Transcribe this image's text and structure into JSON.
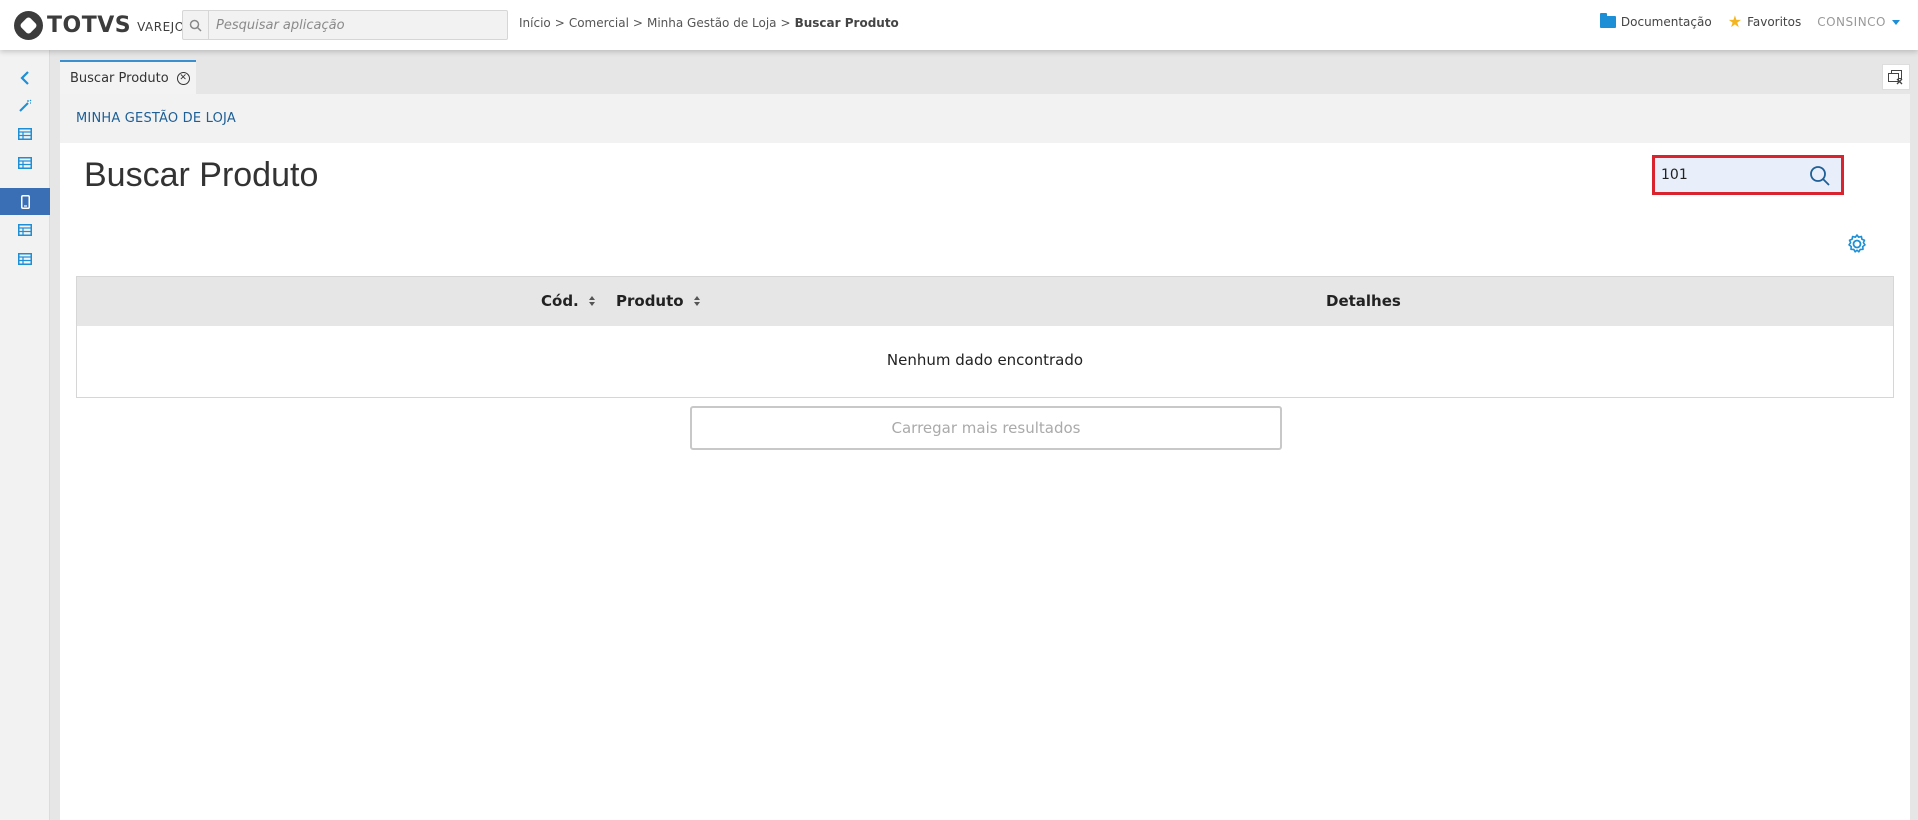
{
  "brand": {
    "name": "TOTVS",
    "product": "VAREJO"
  },
  "app_search": {
    "placeholder": "Pesquisar aplicação",
    "icon": "search-icon"
  },
  "breadcrumb": {
    "items": [
      "Início",
      "Comercial",
      "Minha Gestão de Loja"
    ],
    "current": "Buscar Produto",
    "separator": ">"
  },
  "header_right": {
    "documentation_label": "Documentação",
    "favorites_label": "Favoritos",
    "user_label": "CONSINCO"
  },
  "sidebar": {
    "items": [
      {
        "icon": "chevron-left-icon",
        "active": false
      },
      {
        "icon": "wand-icon",
        "active": false
      },
      {
        "icon": "table-icon",
        "active": false
      },
      {
        "icon": "table-icon",
        "active": false
      },
      {
        "icon": "mobile-icon",
        "active": true
      },
      {
        "icon": "table-icon",
        "active": false
      },
      {
        "icon": "table-icon",
        "active": false
      }
    ]
  },
  "tabs": [
    {
      "label": "Buscar Produto",
      "closable": true
    }
  ],
  "module": {
    "title": "MINHA GESTÃO DE LOJA"
  },
  "page": {
    "title": "Buscar Produto"
  },
  "search": {
    "value": "101",
    "placeholder": ""
  },
  "table": {
    "columns": [
      {
        "label": "Cód.",
        "sortable": true
      },
      {
        "label": "Produto",
        "sortable": true
      },
      {
        "label": "Detalhes",
        "sortable": false
      }
    ],
    "empty_message": "Nenhum dado encontrado"
  },
  "load_more": {
    "label": "Carregar mais resultados"
  },
  "colors": {
    "accent": "#1c8fd6",
    "module_title": "#1d5f96",
    "sidebar_active": "#3a6fb5",
    "highlight_border": "#d9232f",
    "star": "#f3b61f"
  }
}
